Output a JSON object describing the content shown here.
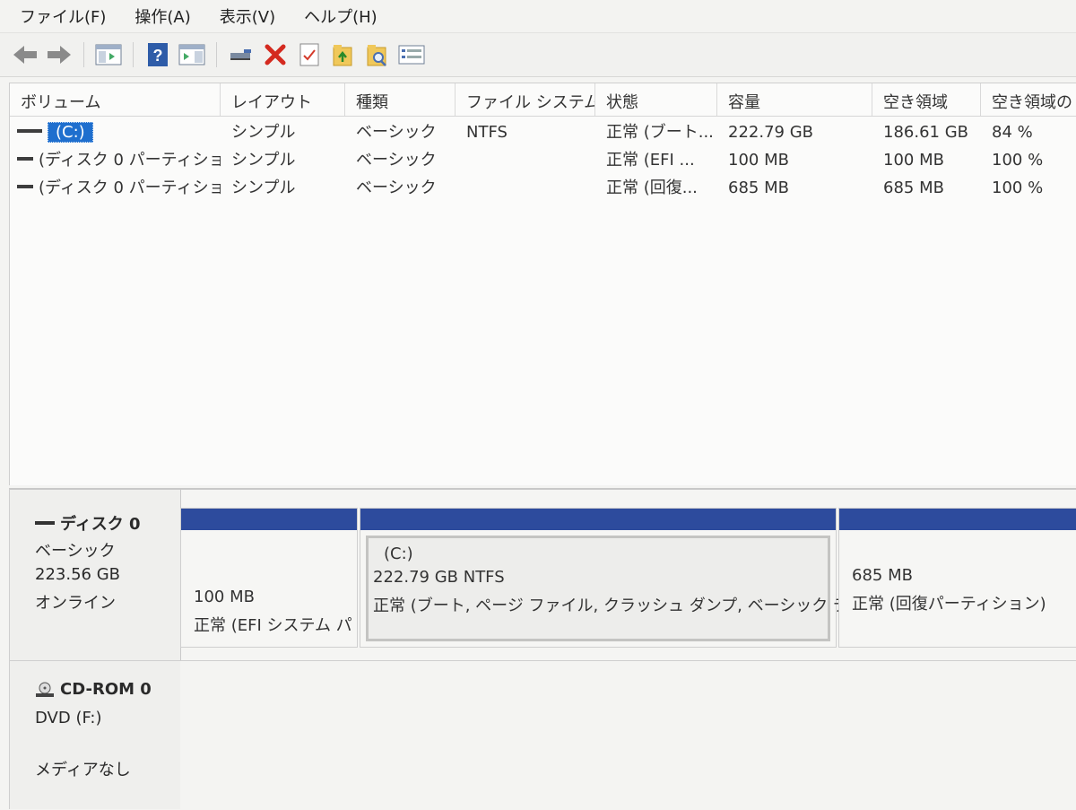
{
  "menu": [
    "ファイル(F)",
    "操作(A)",
    "表示(V)",
    "ヘルプ(H)"
  ],
  "toolbar_icons": [
    "back-arrow-icon",
    "forward-arrow-icon",
    "console-tree-icon",
    "help-icon",
    "action-pane-icon",
    "connect-drive-icon",
    "delete-icon",
    "check-properties-icon",
    "folder-up-icon",
    "folder-search-icon",
    "list-icon"
  ],
  "columns": [
    "ボリューム",
    "レイアウト",
    "種類",
    "ファイル システム",
    "状態",
    "容量",
    "空き領域",
    "空き領域の"
  ],
  "volumes": [
    {
      "name": "(C:)",
      "layout": "シンプル",
      "type": "ベーシック",
      "fs": "NTFS",
      "status": "正常 (ブート...",
      "capacity": "222.79 GB",
      "free": "186.61 GB",
      "pct": "84 %"
    },
    {
      "name": "(ディスク 0 パーティショ...",
      "layout": "シンプル",
      "type": "ベーシック",
      "fs": "",
      "status": "正常 (EFI ...",
      "capacity": "100 MB",
      "free": "100 MB",
      "pct": "100 %"
    },
    {
      "name": "(ディスク 0 パーティショ...",
      "layout": "シンプル",
      "type": "ベーシック",
      "fs": "",
      "status": "正常 (回復...",
      "capacity": "685 MB",
      "free": "685 MB",
      "pct": "100 %"
    }
  ],
  "disk0": {
    "name": "ディスク 0",
    "type": "ベーシック",
    "size": "223.56 GB",
    "state": "オンライン",
    "partitions": [
      {
        "label": "",
        "size": "100 MB",
        "status": "正常 (EFI システム パ"
      },
      {
        "label": "(C:)",
        "size": "222.79 GB NTFS",
        "status": "正常 (ブート, ページ ファイル, クラッシュ ダンプ, ベーシック データ パ"
      },
      {
        "label": "",
        "size": "685 MB",
        "status": "正常 (回復パーティション)"
      }
    ]
  },
  "cdrom": {
    "name": "CD-ROM 0",
    "drive": "DVD (F:)",
    "media": "メディアなし"
  },
  "colors": {
    "partition_bar": "#2d4b9d",
    "selection": "#1f6fce"
  }
}
